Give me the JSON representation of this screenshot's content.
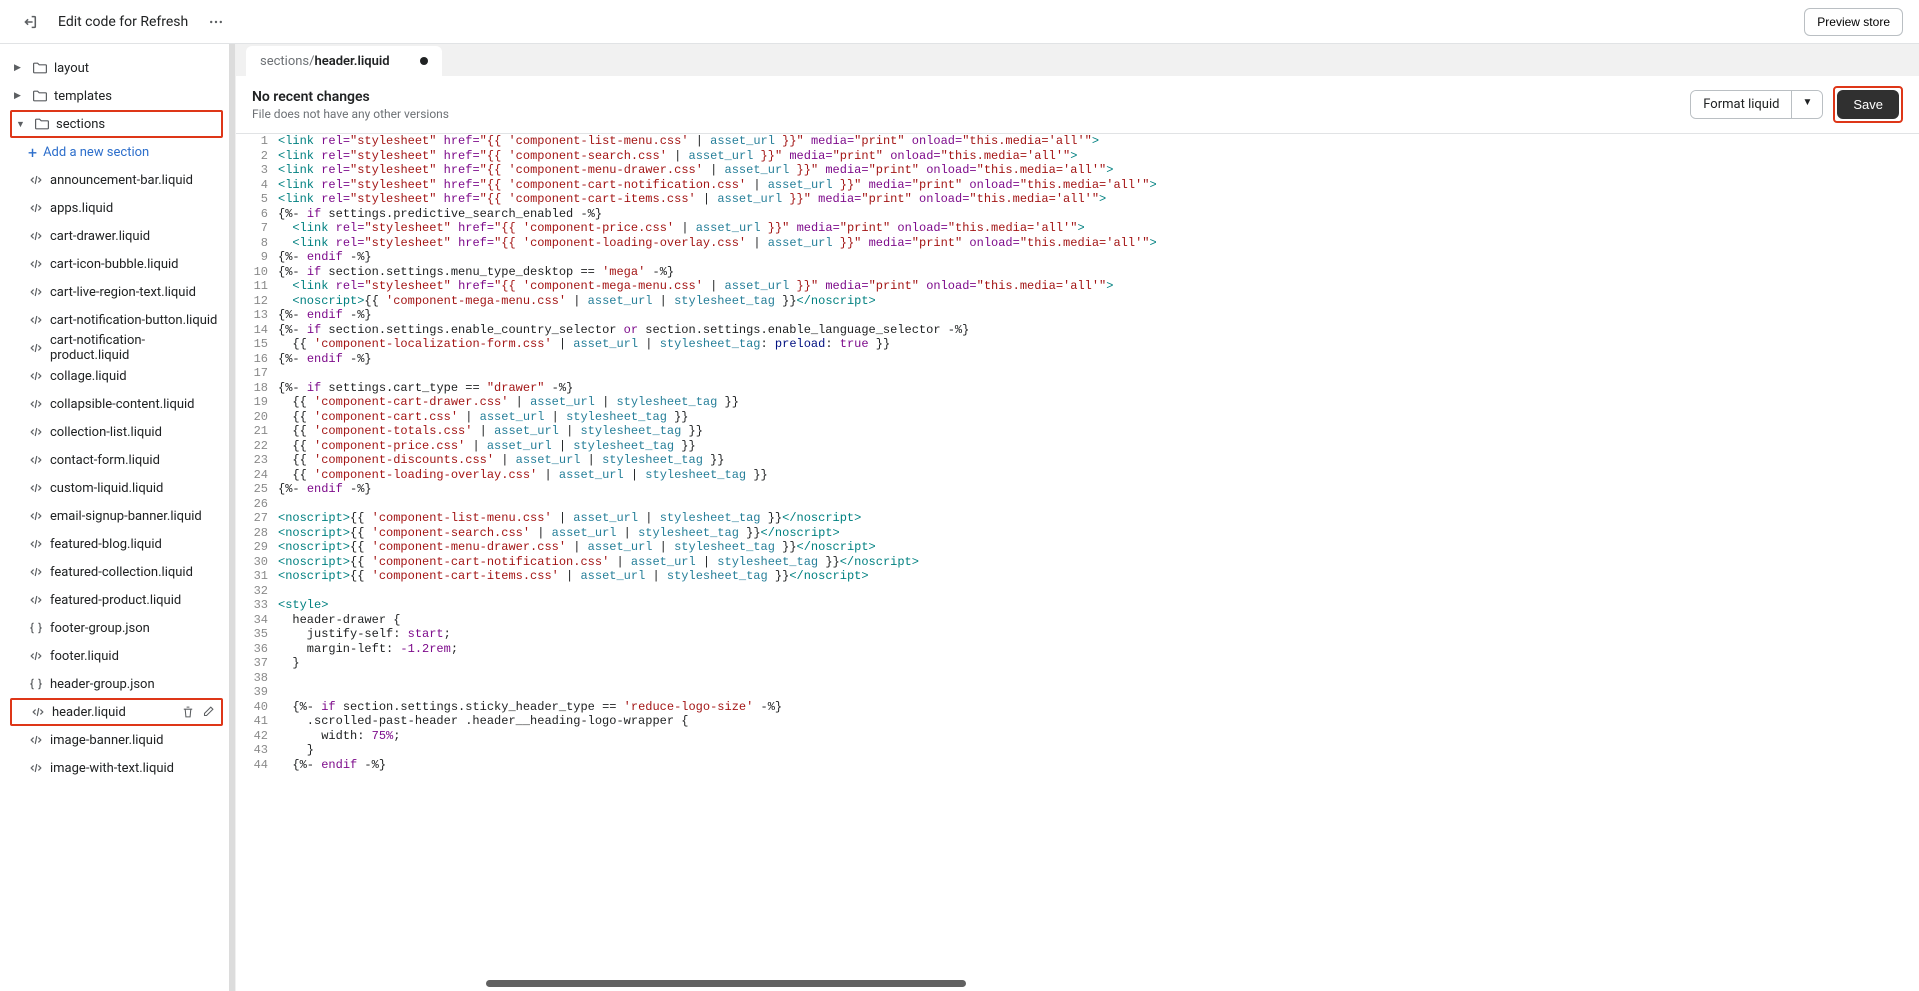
{
  "topbar": {
    "title": "Edit code for Refresh",
    "preview": "Preview store"
  },
  "sidebar": {
    "folders": {
      "layout": "layout",
      "templates": "templates",
      "sections": "sections"
    },
    "add_section": "Add a new section",
    "files": [
      "announcement-bar.liquid",
      "apps.liquid",
      "cart-drawer.liquid",
      "cart-icon-bubble.liquid",
      "cart-live-region-text.liquid",
      "cart-notification-button.liquid",
      "cart-notification-product.liquid",
      "collage.liquid",
      "collapsible-content.liquid",
      "collection-list.liquid",
      "contact-form.liquid",
      "custom-liquid.liquid",
      "email-signup-banner.liquid",
      "featured-blog.liquid",
      "featured-collection.liquid",
      "featured-product.liquid",
      "footer-group.json",
      "footer.liquid",
      "header-group.json",
      "header.liquid",
      "image-banner.liquid",
      "image-with-text.liquid"
    ]
  },
  "tab": {
    "dir": "sections/",
    "file": "header.liquid"
  },
  "editor_header": {
    "title": "No recent changes",
    "sub": "File does not have any other versions",
    "format": "Format liquid",
    "save": "Save"
  },
  "code": {
    "link_tokens": {
      "open": "<link",
      "rel": "rel=",
      "href": "href=",
      "media": "media=",
      "onload": "onload=",
      "stylesheet": "\"stylesheet\"",
      "print": "\"print\"",
      "this_media": "\"this.media='all'\"",
      "close": ">",
      "q_open": "\"{{",
      "q_close": "}}\"",
      "asset_url": "asset_url",
      "pipe": " | "
    },
    "l1_css": "'component-list-menu.css'",
    "l2_css": "'component-search.css'",
    "l3_css": "'component-menu-drawer.css'",
    "l4_css": "'component-cart-notification.css'",
    "l5_css": "'component-cart-items.css'",
    "l6": {
      "a": "{%- ",
      "b": "if",
      "c": " settings.predictive_search_enabled ",
      "d": "-%}"
    },
    "l7_css": "'component-price.css'",
    "l8_css": "'component-loading-overlay.css'",
    "l9": {
      "a": "{%- ",
      "b": "endif",
      "c": " -%}"
    },
    "l10": {
      "a": "{%- ",
      "b": "if",
      "c": " section.settings.menu_type_desktop == ",
      "d": "'mega'",
      "e": " -%}"
    },
    "l11_css": "'component-mega-menu.css'",
    "l12": {
      "ns_o": "<noscript>",
      "dl": "{{ ",
      "css": "'component-mega-menu.css'",
      "p1": " | ",
      "au": "asset_url",
      "p2": " | ",
      "st": "stylesheet_tag",
      "dr": " }}",
      "ns_c": "</noscript>"
    },
    "l13": {
      "a": "{%- ",
      "b": "endif",
      "c": " -%}"
    },
    "l14": {
      "a": "{%- ",
      "b": "if",
      "c": " section.settings.enable_country_selector ",
      "d": "or",
      "e": " section.settings.enable_language_selector ",
      "f": "-%}"
    },
    "l15": {
      "dl": "{{ ",
      "css": "'component-localization-form.css'",
      "p1": " | ",
      "au": "asset_url",
      "p2": " | ",
      "st": "stylesheet_tag",
      "colon": ": ",
      "pre": "preload",
      "tru": "true",
      "dr": " }}"
    },
    "l16": {
      "a": "{%- ",
      "b": "endif",
      "c": " -%}"
    },
    "l18": {
      "a": "{%- ",
      "b": "if",
      "c": " settings.cart_type == ",
      "d": "\"drawer\"",
      "e": " -%}"
    },
    "l19": {
      "dl": "{{ ",
      "css": "'component-cart-drawer.css'",
      "p1": " | ",
      "au": "asset_url",
      "p2": " | ",
      "st": "stylesheet_tag",
      "dr": " }}"
    },
    "l20": {
      "dl": "{{ ",
      "css": "'component-cart.css'",
      "p1": " | ",
      "au": "asset_url",
      "p2": " | ",
      "st": "stylesheet_tag",
      "dr": " }}"
    },
    "l21": {
      "dl": "{{ ",
      "css": "'component-totals.css'",
      "p1": " | ",
      "au": "asset_url",
      "p2": " | ",
      "st": "stylesheet_tag",
      "dr": " }}"
    },
    "l22": {
      "dl": "{{ ",
      "css": "'component-price.css'",
      "p1": " | ",
      "au": "asset_url",
      "p2": " | ",
      "st": "stylesheet_tag",
      "dr": " }}"
    },
    "l23": {
      "dl": "{{ ",
      "css": "'component-discounts.css'",
      "p1": " | ",
      "au": "asset_url",
      "p2": " | ",
      "st": "stylesheet_tag",
      "dr": " }}"
    },
    "l24": {
      "dl": "{{ ",
      "css": "'component-loading-overlay.css'",
      "p1": " | ",
      "au": "asset_url",
      "p2": " | ",
      "st": "stylesheet_tag",
      "dr": " }}"
    },
    "l25": {
      "a": "{%- ",
      "b": "endif",
      "c": " -%}"
    },
    "l27": {
      "ns_o": "<noscript>",
      "dl": "{{ ",
      "css": "'component-list-menu.css'",
      "p1": " | ",
      "au": "asset_url",
      "p2": " | ",
      "st": "stylesheet_tag",
      "dr": " }}",
      "ns_c": "</noscript>"
    },
    "l28": {
      "ns_o": "<noscript>",
      "dl": "{{ ",
      "css": "'component-search.css'",
      "p1": " | ",
      "au": "asset_url",
      "p2": " | ",
      "st": "stylesheet_tag",
      "dr": " }}",
      "ns_c": "</noscript>"
    },
    "l29": {
      "ns_o": "<noscript>",
      "dl": "{{ ",
      "css": "'component-menu-drawer.css'",
      "p1": " | ",
      "au": "asset_url",
      "p2": " | ",
      "st": "stylesheet_tag",
      "dr": " }}",
      "ns_c": "</noscript>"
    },
    "l30": {
      "ns_o": "<noscript>",
      "dl": "{{ ",
      "css": "'component-cart-notification.css'",
      "p1": " | ",
      "au": "asset_url",
      "p2": " | ",
      "st": "stylesheet_tag",
      "dr": " }}",
      "ns_c": "</noscript>"
    },
    "l31": {
      "ns_o": "<noscript>",
      "dl": "{{ ",
      "css": "'component-cart-items.css'",
      "p1": " | ",
      "au": "asset_url",
      "p2": " | ",
      "st": "stylesheet_tag",
      "dr": " }}",
      "ns_c": "</noscript>"
    },
    "l33": "<style>",
    "l34": "  header-drawer {",
    "l35_a": "    justify-self: ",
    "l35_b": "start",
    "l35_c": ";",
    "l36_a": "    margin-left: ",
    "l36_b": "-1.2rem",
    "l36_c": ";",
    "l37": "  }",
    "l40": {
      "a": "{%- ",
      "b": "if",
      "c": " section.settings.sticky_header_type == ",
      "d": "'reduce-logo-size'",
      "e": " -%}"
    },
    "l41": "    .scrolled-past-header .header__heading-logo-wrapper {",
    "l42_a": "      width: ",
    "l42_b": "75%",
    "l42_c": ";",
    "l43": "    }",
    "l44": {
      "a": "  {%- ",
      "b": "endif",
      "c": " -%}"
    },
    "ln": {
      "1": "1",
      "2": "2",
      "3": "3",
      "4": "4",
      "5": "5",
      "6": "6",
      "7": "7",
      "8": "8",
      "9": "9",
      "10": "10",
      "11": "11",
      "12": "12",
      "13": "13",
      "14": "14",
      "15": "15",
      "16": "16",
      "17": "17",
      "18": "18",
      "19": "19",
      "20": "20",
      "21": "21",
      "22": "22",
      "23": "23",
      "24": "24",
      "25": "25",
      "26": "26",
      "27": "27",
      "28": "28",
      "29": "29",
      "30": "30",
      "31": "31",
      "32": "32",
      "33": "33",
      "34": "34",
      "35": "35",
      "36": "36",
      "37": "37",
      "38": "38",
      "39": "39",
      "40": "40",
      "41": "41",
      "42": "42",
      "43": "43",
      "44": "44"
    }
  }
}
